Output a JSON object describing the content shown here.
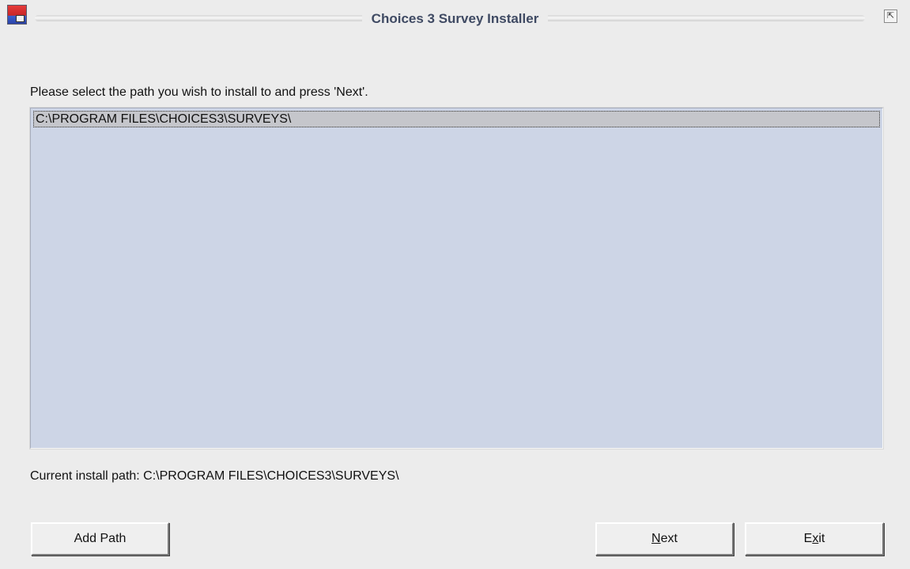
{
  "window": {
    "title": "Choices 3 Survey Installer",
    "icons": {
      "app": "installer-app-icon",
      "restore": "restore-window-icon"
    }
  },
  "main": {
    "instruction": "Please select the path you wish to install to and press 'Next'.",
    "paths": [
      "C:\\PROGRAM FILES\\CHOICES3\\SURVEYS\\"
    ],
    "current_path_label": "Current install path: C:\\PROGRAM FILES\\CHOICES3\\SURVEYS\\"
  },
  "buttons": {
    "add_path": "Add Path",
    "next": "Next",
    "exit": "Exit"
  },
  "colors": {
    "window_bg": "#ececec",
    "list_bg": "#cdd5e6",
    "selected_item_bg": "#c5c6cb",
    "title_text": "#3f4a63"
  }
}
